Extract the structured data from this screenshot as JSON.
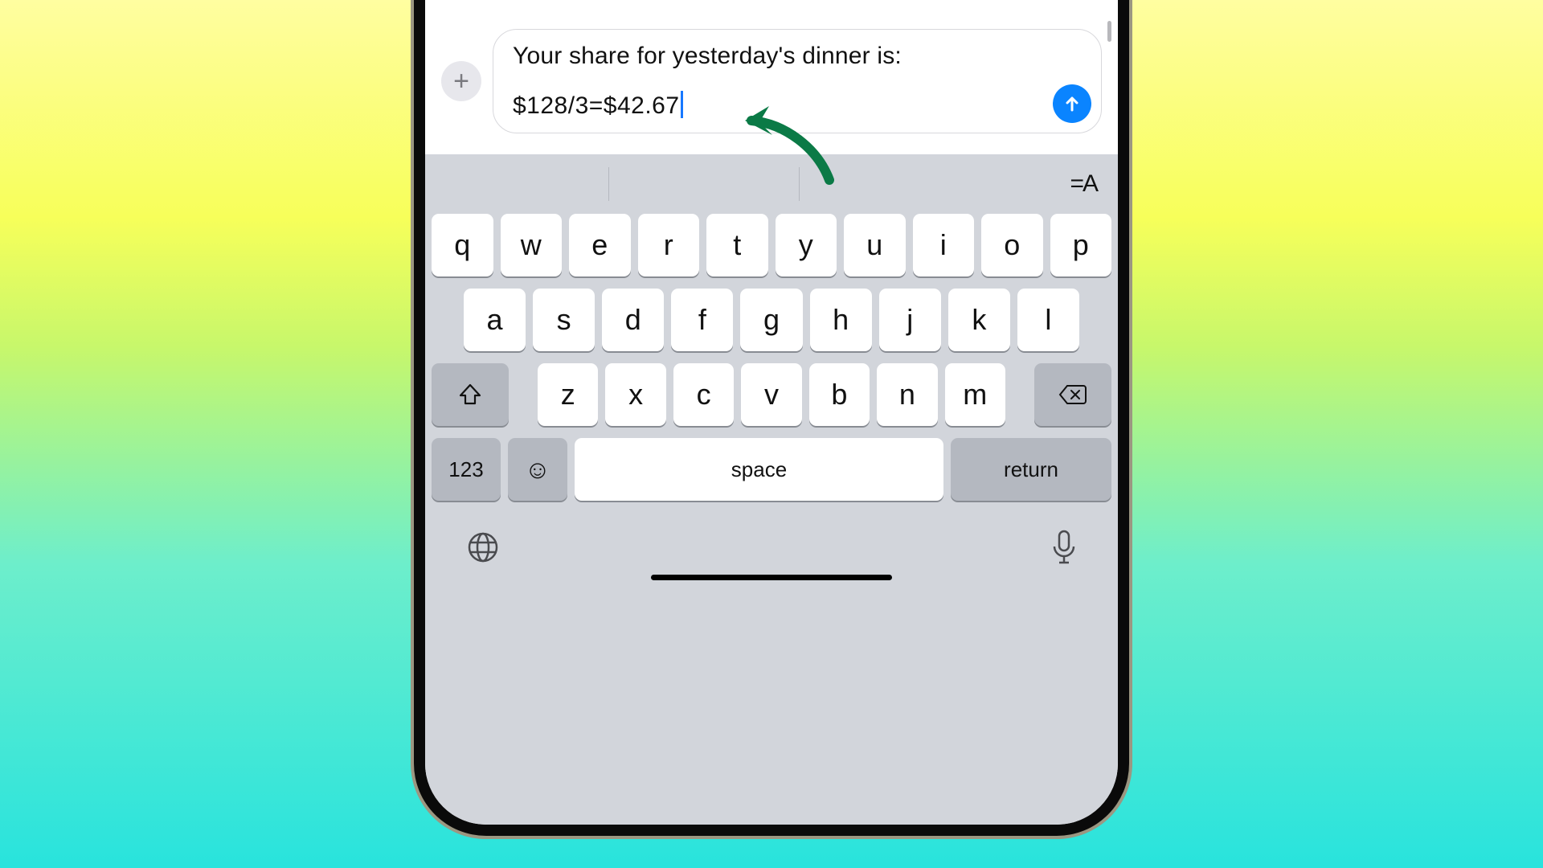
{
  "compose": {
    "line1": "Your share for yesterday's dinner is:",
    "line2": "$128/3=$42.67"
  },
  "keyboard": {
    "row1": [
      "q",
      "w",
      "e",
      "r",
      "t",
      "y",
      "u",
      "i",
      "o",
      "p"
    ],
    "row2": [
      "a",
      "s",
      "d",
      "f",
      "g",
      "h",
      "j",
      "k",
      "l"
    ],
    "row3": [
      "z",
      "x",
      "c",
      "v",
      "b",
      "n",
      "m"
    ],
    "numbers_label": "123",
    "space_label": "space",
    "return_label": "return",
    "format_label": "=A"
  },
  "colors": {
    "send_button": "#0a84ff",
    "annotation_arrow": "#0b7a46"
  }
}
